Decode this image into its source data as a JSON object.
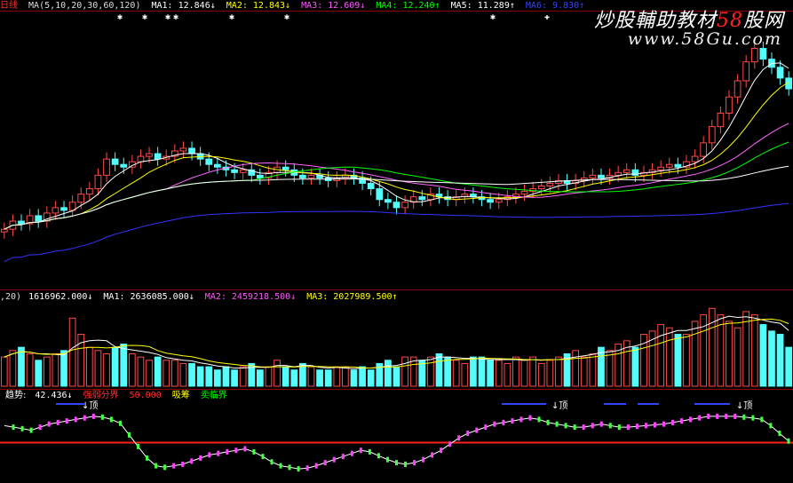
{
  "header": {
    "period": "日线",
    "ma_params": "MA(5,10,20,30,60,120)",
    "ma1": "MA1: 12.846↓",
    "ma2": "MA2: 12.843↓",
    "ma3": "MA3: 12.609↓",
    "ma4": "MA4: 12.240↑",
    "ma5": "MA5: 11.289↑",
    "ma6": "MA6: 9.830↑"
  },
  "watermark": {
    "line1_prefix": "炒股輔助教材",
    "line1_num": "58",
    "line1_suffix": "股网",
    "line2": "www.58Gu.com"
  },
  "volume_header": {
    "params": ",20)",
    "vol": "1616962.000↓",
    "ma1": "MA1: 2636085.000↓",
    "ma2": "MA2: 2459218.500↓",
    "ma3": "MA3: 2027989.500↑"
  },
  "indicator_header": {
    "name": "趋势:",
    "value": "42.436↓",
    "line1": "强弱分界",
    "line2": "50.000",
    "line3": "吸筹",
    "line4": "卖临界"
  },
  "markers": {
    "top1": "↓顶",
    "top2": "↓顶",
    "top3": "↓顶"
  },
  "colors": {
    "up": "#ff4a4a",
    "down": "#54fcfc",
    "ma1": "#ffffff",
    "ma2": "#ffff00",
    "ma3": "#ff66ff",
    "ma4": "#00ff00",
    "ma5": "#ffffff",
    "ma6": "#3333ff"
  },
  "chart_data": {
    "type": "line",
    "close": [
      11.6,
      11.9,
      11.8,
      12.1,
      11.9,
      12.2,
      12.4,
      12.3,
      12.6,
      12.9,
      13.1,
      13.6,
      14.2,
      14.0,
      13.9,
      14.1,
      14.3,
      14.4,
      14.2,
      14.3,
      14.5,
      14.6,
      14.4,
      14.2,
      14.0,
      13.9,
      13.8,
      13.7,
      13.8,
      13.6,
      13.5,
      13.7,
      13.9,
      13.8,
      13.6,
      13.5,
      13.6,
      13.5,
      13.4,
      13.5,
      13.6,
      13.5,
      13.3,
      13.1,
      12.7,
      12.6,
      12.4,
      12.6,
      12.8,
      12.7,
      12.9,
      12.8,
      12.7,
      12.8,
      12.9,
      12.8,
      12.7,
      12.6,
      12.7,
      12.8,
      12.9,
      13.0,
      13.1,
      13.2,
      13.3,
      13.4,
      13.3,
      13.4,
      13.5,
      13.6,
      13.5,
      13.6,
      13.7,
      13.8,
      13.6,
      13.7,
      13.8,
      13.9,
      14.0,
      13.9,
      14.1,
      14.3,
      14.8,
      15.4,
      15.9,
      16.5,
      17.1,
      17.8,
      18.3,
      17.9,
      17.6,
      17.2,
      16.8
    ],
    "ylim": [
      9.5,
      19.5
    ],
    "volume": [
      0.9,
      1.1,
      1.2,
      1.0,
      0.8,
      0.9,
      1.0,
      1.1,
      2.1,
      1.6,
      1.2,
      1.1,
      1.0,
      1.2,
      1.3,
      1.0,
      0.9,
      0.8,
      0.9,
      0.8,
      0.8,
      0.7,
      0.7,
      0.6,
      0.6,
      0.5,
      0.6,
      0.5,
      0.6,
      0.7,
      0.5,
      0.6,
      0.8,
      0.6,
      0.5,
      0.7,
      0.6,
      0.5,
      0.5,
      0.6,
      0.6,
      0.5,
      0.6,
      0.5,
      0.7,
      0.8,
      0.6,
      0.9,
      0.9,
      0.8,
      0.9,
      1.0,
      0.9,
      0.8,
      0.7,
      0.9,
      0.9,
      0.8,
      0.8,
      0.7,
      0.9,
      0.8,
      0.9,
      0.7,
      0.8,
      0.9,
      1.0,
      1.1,
      0.9,
      1.0,
      1.2,
      1.1,
      1.3,
      1.4,
      1.2,
      1.6,
      1.7,
      1.9,
      1.8,
      1.6,
      1.6,
      2.0,
      2.2,
      2.4,
      2.2,
      2.0,
      1.8,
      2.3,
      2.2,
      1.9,
      1.7,
      1.6,
      1.2
    ],
    "volume_ylim": [
      0,
      2.6
    ],
    "trend": [
      72,
      70,
      68,
      66,
      70,
      74,
      76,
      78,
      80,
      82,
      84,
      83,
      80,
      75,
      60,
      45,
      30,
      20,
      18,
      20,
      22,
      26,
      30,
      34,
      36,
      38,
      40,
      42,
      38,
      32,
      25,
      20,
      18,
      16,
      17,
      20,
      24,
      28,
      32,
      36,
      40,
      38,
      33,
      28,
      24,
      22,
      24,
      28,
      34,
      40,
      48,
      56,
      62,
      66,
      70,
      74,
      76,
      78,
      80,
      82,
      80,
      76,
      74,
      72,
      70,
      70,
      72,
      74,
      72,
      70,
      70,
      71,
      72,
      73,
      74,
      76,
      78,
      80,
      82,
      84,
      84,
      84,
      84,
      83,
      82,
      80,
      72,
      62,
      52
    ],
    "trend_ylim": [
      0,
      100
    ],
    "strength_line": 50
  }
}
